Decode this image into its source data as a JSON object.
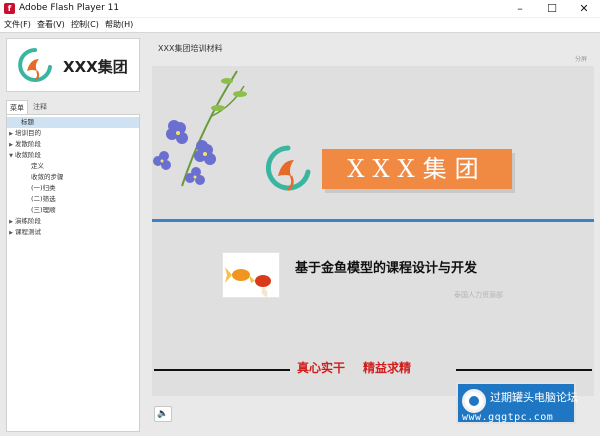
{
  "window": {
    "title": "Adobe Flash Player 11",
    "app_icon": "flash-icon",
    "minimize": "–",
    "maximize": "☐",
    "close": "✕"
  },
  "menu": [
    "文件(F)",
    "查看(V)",
    "控制(C)",
    "帮助(H)"
  ],
  "sidebar": {
    "logo_text": "XXX集团",
    "tabs": [
      "菜单",
      "注释"
    ],
    "tree": [
      {
        "label": "标题",
        "level": 1,
        "arrow": "",
        "selected": true
      },
      {
        "label": "培训目的",
        "level": 0,
        "arrow": "▶"
      },
      {
        "label": "发散阶段",
        "level": 0,
        "arrow": "▶"
      },
      {
        "label": "收敛阶段",
        "level": 0,
        "arrow": "▼"
      },
      {
        "label": "定义",
        "level": 2,
        "arrow": ""
      },
      {
        "label": "收敛的步骤",
        "level": 2,
        "arrow": ""
      },
      {
        "label": "(一)归类",
        "level": 2,
        "arrow": ""
      },
      {
        "label": "(二)筛选",
        "level": 2,
        "arrow": ""
      },
      {
        "label": "(三)理顺",
        "level": 2,
        "arrow": ""
      },
      {
        "label": "演练阶段",
        "level": 0,
        "arrow": "▶"
      },
      {
        "label": "课程测试",
        "level": 0,
        "arrow": "▶"
      }
    ]
  },
  "content": {
    "course_title": "XXX集团培训材料",
    "topright_label": "分屏",
    "slide": {
      "banner_text": "XXX集团",
      "heading": "基于金鱼模型的课程设计与开发",
      "watermark": "泰国人力资源部",
      "motto_left": "真心实干",
      "motto_right": "精益求精"
    },
    "sound_icon": "🔈"
  },
  "overlay": {
    "forum_title": "过期罐头电脑论坛",
    "forum_url": "www.gqgtpc.com"
  },
  "colors": {
    "banner": "#f08a43",
    "accent_line": "#3b82c4",
    "motto": "#d01d1d",
    "forum_bg": "#1f77c3",
    "logo_teal": "#3ab5a0",
    "logo_orange": "#e46b2a"
  }
}
